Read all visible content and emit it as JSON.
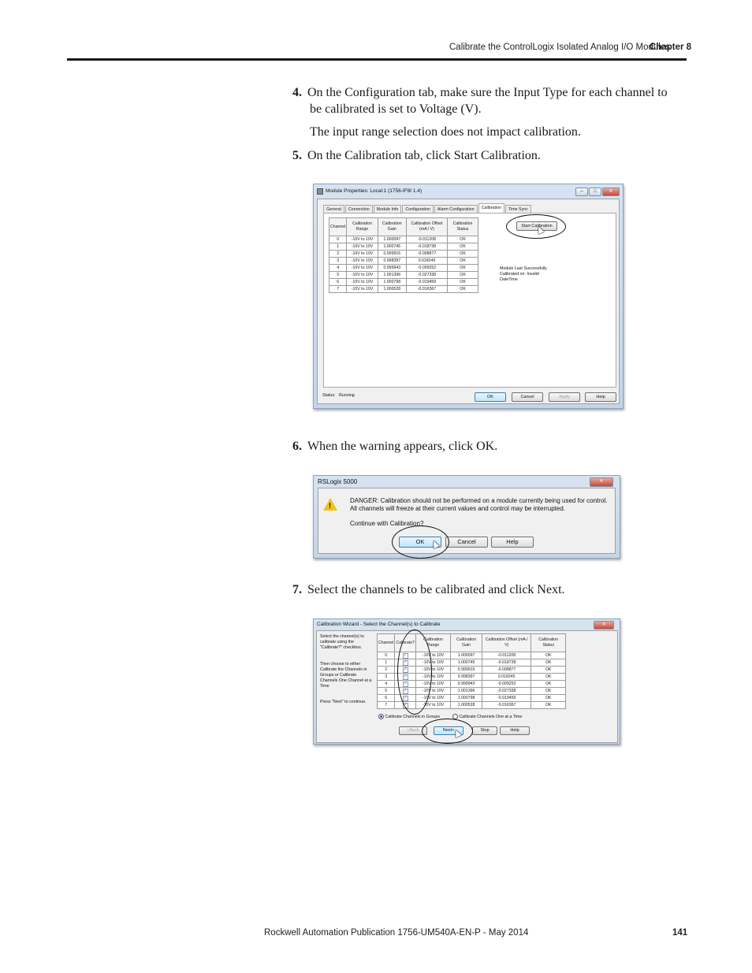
{
  "header": {
    "title": "Calibrate the ControlLogix Isolated Analog I/O Modules",
    "chapter": "Chapter 8"
  },
  "steps": [
    {
      "num": "4.",
      "line1": "On the Configuration tab, make sure the Input Type for each channel to",
      "line2": "be calibrated is set to Voltage (V)."
    },
    {
      "note": "The input range selection does not impact calibration."
    },
    {
      "num": "5.",
      "text": "On the Calibration tab, click Start Calibration."
    },
    {
      "num": "6.",
      "text": "When the warning appears, click OK."
    },
    {
      "num": "7.",
      "text": "Select the channels to be calibrated and click Next."
    }
  ],
  "module_props": {
    "title": "Module Properties: Local:1 (1756-IF8I 1.4)",
    "tabs": [
      "General",
      "Connection",
      "Module Info",
      "Configuration",
      "Alarm Configuration",
      "Calibration",
      "Time Sync"
    ],
    "active_tab": "Calibration",
    "headers": [
      "Channel",
      "Calibration Range",
      "Calibration Gain",
      "Calibration Offset (mA / V)",
      "Calibration Status"
    ],
    "rows": [
      [
        "0",
        "-10V to 10V",
        "1.000097",
        "-0.011208",
        "OK"
      ],
      [
        "1",
        "-10V to 10V",
        "1.000745",
        "-0.018738",
        "OK"
      ],
      [
        "2",
        "-10V to 10V",
        "0.999915",
        "-0.008877",
        "OK"
      ],
      [
        "3",
        "-10V to 10V",
        "0.998397",
        "0.018245",
        "OK"
      ],
      [
        "4",
        "-10V to 10V",
        "0.999943",
        "-0.009252",
        "OK"
      ],
      [
        "5",
        "-10V to 10V",
        "1.001396",
        "-0.027338",
        "OK"
      ],
      [
        "6",
        "-10V to 10V",
        "1.000798",
        "-0.019459",
        "OK"
      ],
      [
        "7",
        "-10V to 10V",
        "1.000528",
        "-0.016367",
        "OK"
      ]
    ],
    "start_button": "Start Calibration",
    "status_line1": "Module Last Successfully",
    "status_line2": "Calibrated on:  Invalid",
    "status_line3": "DateTime",
    "status_label": "Status:",
    "status_value": "Running",
    "ok": "OK",
    "cancel": "Cancel",
    "apply": "Apply",
    "help": "Help"
  },
  "warning": {
    "title": "RSLogix 5000",
    "line1": "DANGER: Calibration should not be performed on a module currently being used for control.",
    "line2": "All channels will freeze at their current values and control may be interrupted.",
    "question": "Continue with Calibration?",
    "ok": "OK",
    "cancel": "Cancel",
    "help": "Help"
  },
  "wizard": {
    "title": "Calibration Wizard - Select the Channel(s) to Calibrate",
    "instr1": "Select the channel(s) to calibrate using the \"Calibrate?\" checkbox.",
    "instr2": "Then choose to either Calibrate the Channels in Groups or Calibrate Channels One Channel at a Time",
    "instr3": "Press \"Next\" to continue.",
    "headers": [
      "Channel",
      "Calibrate?",
      "Calibration Range",
      "Calibration Gain",
      "Calibration Offset (mA / V)",
      "Calibration Status"
    ],
    "rows": [
      [
        "0",
        "-10V to 10V",
        "1.000097",
        "-0.011208",
        "OK"
      ],
      [
        "1",
        "-10V to 10V",
        "1.000745",
        "-0.018738",
        "OK"
      ],
      [
        "2",
        "-10V to 10V",
        "0.999915",
        "-0.008877",
        "OK"
      ],
      [
        "3",
        "-10V to 10V",
        "0.998397",
        "0.018245",
        "OK"
      ],
      [
        "4",
        "-10V to 10V",
        "0.999943",
        "-0.009252",
        "OK"
      ],
      [
        "5",
        "-10V to 10V",
        "1.001396",
        "-0.027338",
        "OK"
      ],
      [
        "6",
        "-10V to 10V",
        "1.000798",
        "-0.019459",
        "OK"
      ],
      [
        "7",
        "-10V to 10V",
        "1.000528",
        "-0.016367",
        "OK"
      ]
    ],
    "radio_groups": "Calibrate Channels in Groups",
    "radio_one": "Calibrate Channels One at a Time",
    "back": "<Back",
    "next": "Next>",
    "stop": "Stop",
    "help": "Help"
  },
  "footer": {
    "publication": "Rockwell Automation Publication 1756-UM540A-EN-P - May 2014",
    "page": "141"
  }
}
